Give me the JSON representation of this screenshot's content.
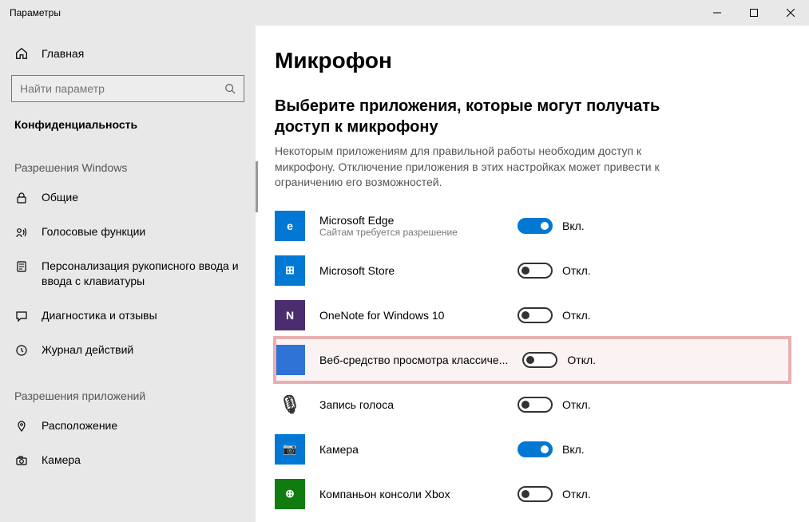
{
  "titlebar": {
    "title": "Параметры"
  },
  "sidebar": {
    "home": "Главная",
    "search_placeholder": "Найти параметр",
    "category": "Конфиденциальность",
    "section_windows": "Разрешения Windows",
    "section_apps": "Разрешения приложений",
    "nav_windows": [
      {
        "label": "Общие"
      },
      {
        "label": "Голосовые функции"
      },
      {
        "label": "Персонализация рукописного ввода и ввода с клавиатуры"
      },
      {
        "label": "Диагностика и отзывы"
      },
      {
        "label": "Журнал действий"
      }
    ],
    "nav_apps": [
      {
        "label": "Расположение"
      },
      {
        "label": "Камера"
      }
    ]
  },
  "main": {
    "title": "Микрофон",
    "subtitle": "Выберите приложения, которые могут получать доступ к микрофону",
    "description": "Некоторым приложениям для правильной работы необходим доступ к микрофону. Отключение приложения в этих настройках может привести к ограничению его возможностей.",
    "state_on": "Вкл.",
    "state_off": "Откл.",
    "apps": [
      {
        "name": "Microsoft Edge",
        "sub": "Сайтам требуется разрешение",
        "on": true,
        "icon_bg": "bg-blue",
        "glyph": "e"
      },
      {
        "name": "Microsoft Store",
        "sub": "",
        "on": false,
        "icon_bg": "bg-blue",
        "glyph": "⊞"
      },
      {
        "name": "OneNote for Windows 10",
        "sub": "",
        "on": false,
        "icon_bg": "bg-darkpurple",
        "glyph": "N"
      },
      {
        "name": "Веб-средство просмотра классиче...",
        "sub": "",
        "on": false,
        "icon_bg": "bg-solidblue",
        "glyph": "",
        "highlight": true
      },
      {
        "name": "Запись голоса",
        "sub": "",
        "on": false,
        "icon_bg": "",
        "glyph": "🎙"
      },
      {
        "name": "Камера",
        "sub": "",
        "on": true,
        "icon_bg": "bg-blue",
        "glyph": "📷"
      },
      {
        "name": "Компаньон консоли Xbox",
        "sub": "",
        "on": false,
        "icon_bg": "bg-green",
        "glyph": "⊕"
      }
    ]
  }
}
